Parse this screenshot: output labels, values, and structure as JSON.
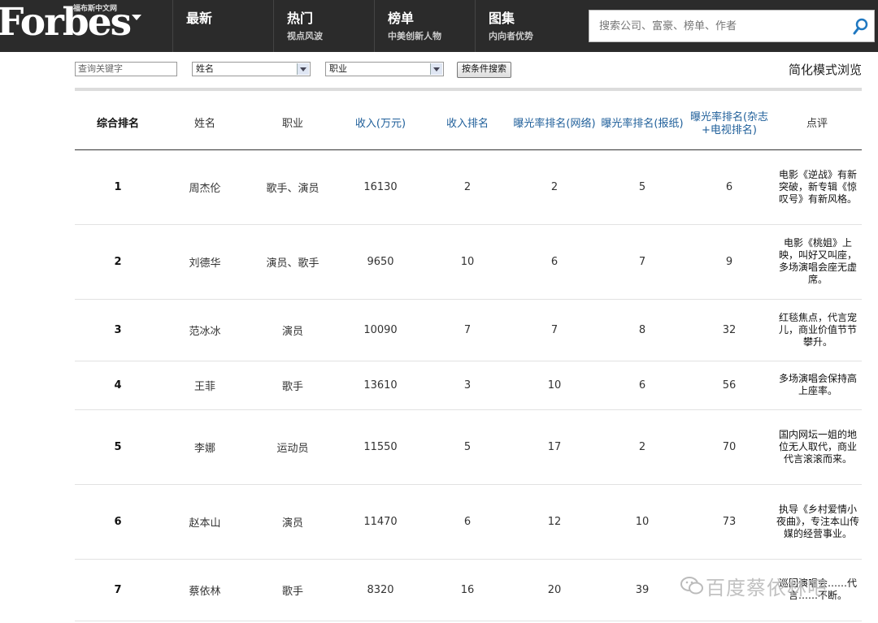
{
  "header": {
    "logo_text": "Forbes",
    "logo_sub": "福布斯中文网",
    "nav": [
      {
        "title": "最新",
        "sub": ""
      },
      {
        "title": "热门",
        "sub": "视点风波"
      },
      {
        "title": "榜单",
        "sub": "中美创新人物"
      },
      {
        "title": "图集",
        "sub": "内向者优势"
      }
    ],
    "search_placeholder": "搜索公司、富豪、榜单、作者"
  },
  "filters": {
    "keyword_placeholder": "查询关键字",
    "name_select": "姓名",
    "job_select": "职业",
    "search_button": "按条件搜索",
    "mode_link": "简化模式浏览"
  },
  "table": {
    "columns": [
      "综合排名",
      "姓名",
      "职业",
      "收入(万元)",
      "收入排名",
      "曝光率排名(网络)",
      "曝光率排名(报纸)",
      "曝光率排名(杂志+电视排名)",
      "点评"
    ],
    "rows": [
      {
        "rank": "1",
        "name": "周杰伦",
        "job": "歌手、演员",
        "income": "16130",
        "income_rank": "2",
        "net": "2",
        "paper": "5",
        "mag": "6",
        "comment": "电影《逆战》有新突破，新专辑《惊叹号》有新风格。"
      },
      {
        "rank": "2",
        "name": "刘德华",
        "job": "演员、歌手",
        "income": "9650",
        "income_rank": "10",
        "net": "6",
        "paper": "7",
        "mag": "9",
        "comment": "电影《桃姐》上映，叫好又叫座，多场演唱会座无虚席。"
      },
      {
        "rank": "3",
        "name": "范冰冰",
        "job": "演员",
        "income": "10090",
        "income_rank": "7",
        "net": "7",
        "paper": "8",
        "mag": "32",
        "comment": "红毯焦点，代言宠儿，商业价值节节攀升。"
      },
      {
        "rank": "4",
        "name": "王菲",
        "job": "歌手",
        "income": "13610",
        "income_rank": "3",
        "net": "10",
        "paper": "6",
        "mag": "56",
        "comment": "多场演唱会保持高上座率。"
      },
      {
        "rank": "5",
        "name": "李娜",
        "job": "运动员",
        "income": "11550",
        "income_rank": "5",
        "net": "17",
        "paper": "2",
        "mag": "70",
        "comment": "国内网坛一姐的地位无人取代，商业代言滚滚而来。"
      },
      {
        "rank": "6",
        "name": "赵本山",
        "job": "演员",
        "income": "11470",
        "income_rank": "6",
        "net": "12",
        "paper": "10",
        "mag": "73",
        "comment": "执导《乡村爱情小夜曲》，专注本山传媒的经营事业。"
      },
      {
        "rank": "7",
        "name": "蔡依林",
        "job": "歌手",
        "income": "8320",
        "income_rank": "16",
        "net": "20",
        "paper": "39",
        "mag": "",
        "comment": "巡回演唱会……代言……不断。"
      }
    ]
  },
  "watermark": "百度蔡依林吧"
}
